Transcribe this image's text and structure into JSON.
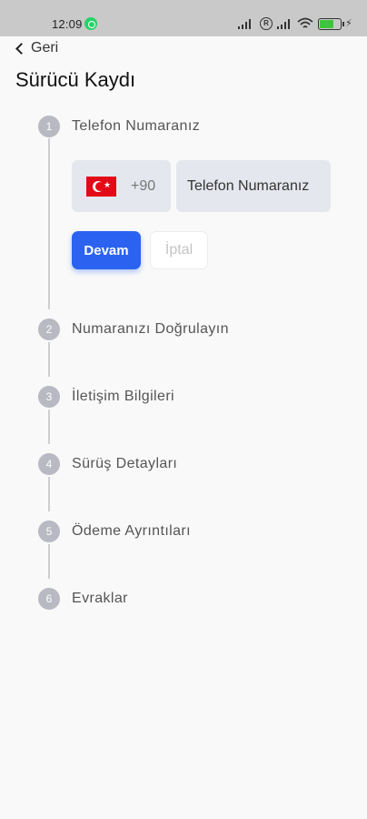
{
  "status_bar": {
    "time": "12:09",
    "icons": [
      "whatsapp-icon",
      "signal-icon",
      "r-icon",
      "signal-icon",
      "wifi-icon",
      "battery-icon",
      "charging-icon"
    ],
    "battery_color": "#3ec43e"
  },
  "header": {
    "back_label": "Geri",
    "title": "Sürücü Kaydı"
  },
  "steps": [
    {
      "number": "1",
      "label": "Telefon Numaranız"
    },
    {
      "number": "2",
      "label": "Numaranızı Doğrulayın"
    },
    {
      "number": "3",
      "label": "İletişim Bilgileri"
    },
    {
      "number": "4",
      "label": "Sürüş Detayları"
    },
    {
      "number": "5",
      "label": "Ödeme Ayrıntıları"
    },
    {
      "number": "6",
      "label": "Evraklar"
    }
  ],
  "phone_form": {
    "country_flag": "turkey-flag-icon",
    "country_code": "+90",
    "phone_placeholder": "Telefon Numaranız",
    "phone_value": ""
  },
  "actions": {
    "continue_label": "Devam",
    "cancel_label": "İptal"
  },
  "colors": {
    "primary": "#2b63f0",
    "step_circle": "#b8b9c2",
    "input_bg": "#e5e7ee"
  }
}
